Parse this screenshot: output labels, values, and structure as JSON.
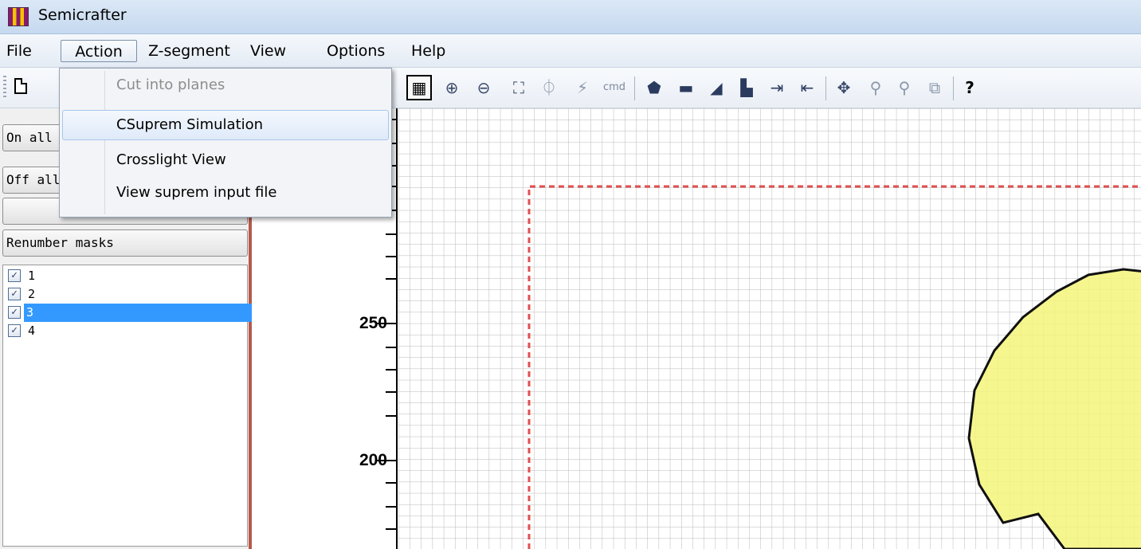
{
  "window": {
    "title": "Semicrafter",
    "app_icon": "semicrafter-app-icon"
  },
  "menubar": {
    "items": [
      {
        "label": "File"
      },
      {
        "label": "Action"
      },
      {
        "label": "Z-segment"
      },
      {
        "label": "View"
      },
      {
        "label": "Options"
      },
      {
        "label": "Help"
      }
    ],
    "open_menu": "Action"
  },
  "action_menu": {
    "items": [
      {
        "label": "Cut into planes",
        "state": "disabled"
      },
      {
        "label": "CSuprem Simulation",
        "state": "hover"
      },
      {
        "label": "Crosslight View",
        "state": "normal"
      },
      {
        "label": "View suprem input file",
        "state": "normal"
      }
    ]
  },
  "toolbar": {
    "icons": [
      "new-document-icon",
      "grid-toggle-icon",
      "zoom-in-icon",
      "zoom-out-icon",
      "zoom-fit-icon",
      "split-icon",
      "lightning-icon",
      "cmd-icon",
      "polygon-icon",
      "rectangle-icon",
      "arrow-shape-icon",
      "stack-shape-icon",
      "stretch-right-icon",
      "stretch-left-icon",
      "move-icon",
      "zoom-plus-icon",
      "zoom-minus-icon",
      "zoom-box-icon",
      "help-icon"
    ],
    "cmd_label": "cmd"
  },
  "left_panel": {
    "on_all_button": "On all",
    "off_all_button": "Off all",
    "renumber_button": "Renumber masks",
    "masks": [
      {
        "label": "1",
        "checked": true,
        "selected": false
      },
      {
        "label": "2",
        "checked": true,
        "selected": false
      },
      {
        "label": "3",
        "checked": true,
        "selected": true
      },
      {
        "label": "4",
        "checked": true,
        "selected": false
      }
    ]
  },
  "ruler": {
    "labels": [
      "250",
      "200"
    ]
  },
  "canvas": {
    "grid": true,
    "boundary_color": "#e05050",
    "shape_fill": "#f5f57a",
    "shape_stroke": "#111111"
  }
}
